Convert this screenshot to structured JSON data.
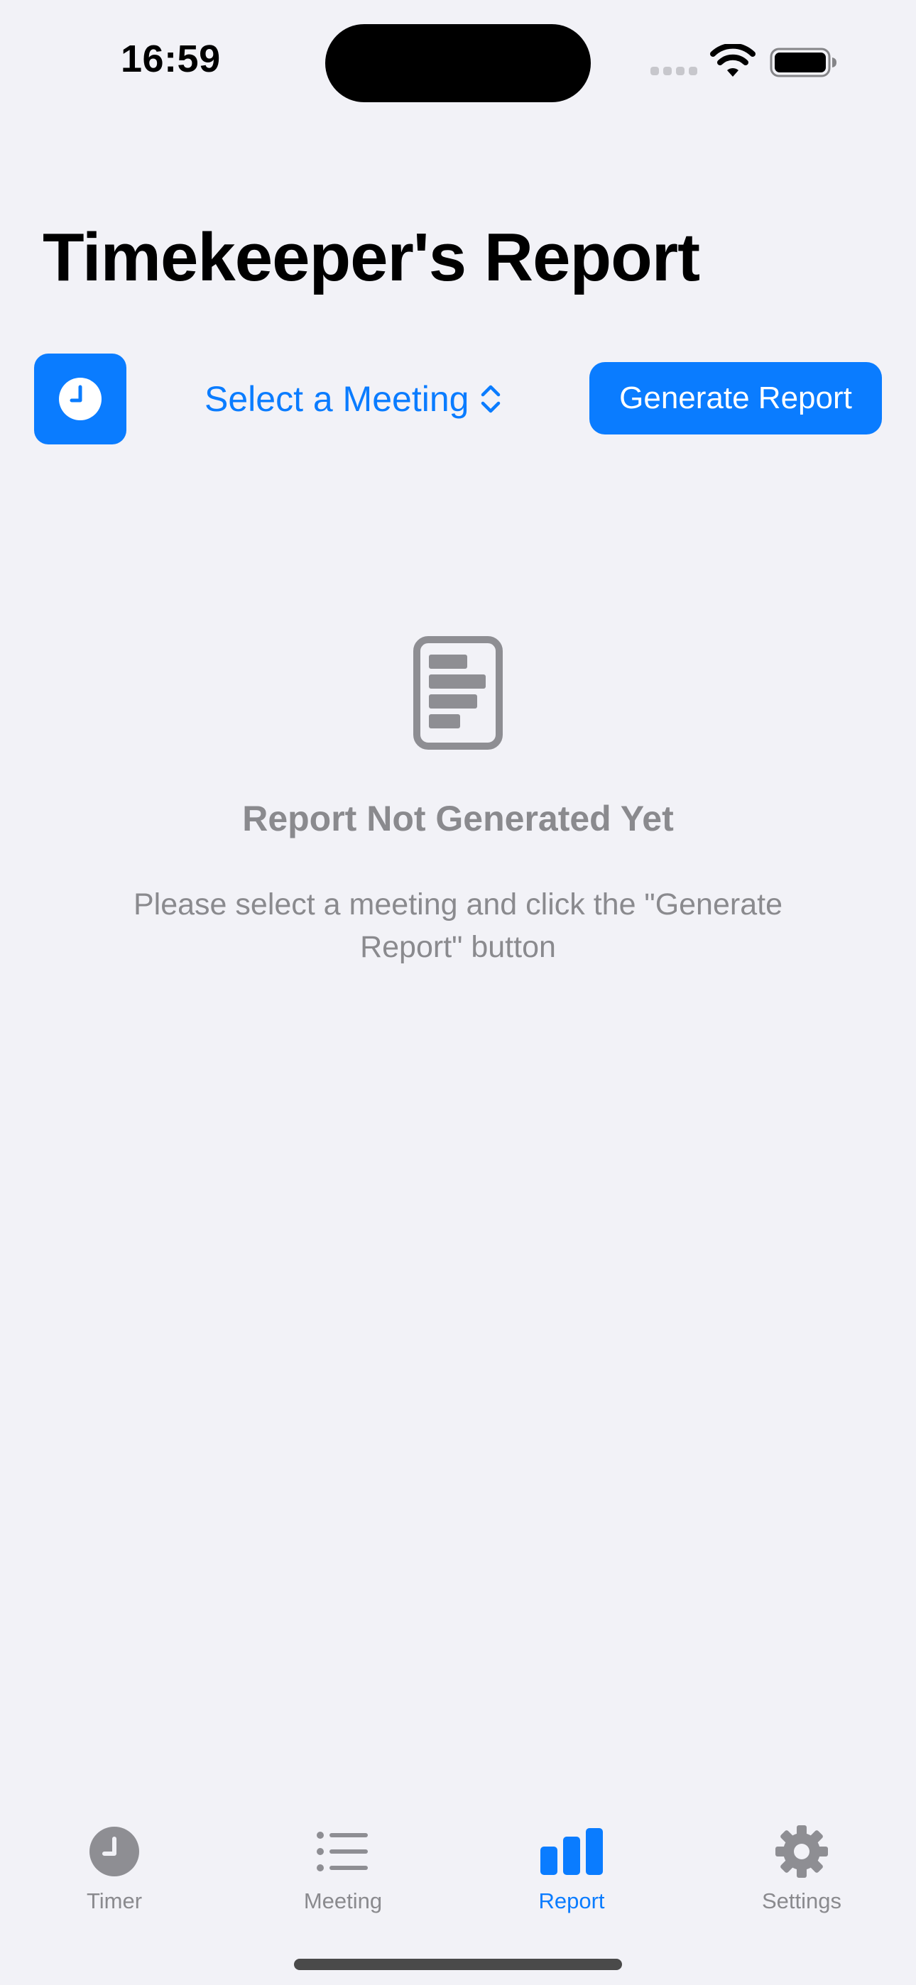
{
  "status_bar": {
    "time": "16:59"
  },
  "header": {
    "title": "Timekeeper's Report"
  },
  "toolbar": {
    "meeting_picker_label": "Select a Meeting",
    "generate_label": "Generate Report"
  },
  "empty_state": {
    "title": "Report Not Generated Yet",
    "message": "Please select a meeting and click the \"Generate Report\" button"
  },
  "tabs": [
    {
      "label": "Timer",
      "icon": "clock-icon",
      "active": false
    },
    {
      "label": "Meeting",
      "icon": "list-icon",
      "active": false
    },
    {
      "label": "Report",
      "icon": "bar-chart-icon",
      "active": true
    },
    {
      "label": "Settings",
      "icon": "gear-icon",
      "active": false
    }
  ],
  "colors": {
    "accent": "#0a7cff",
    "background": "#f2f2f7",
    "secondary_text": "#8a8a8e"
  }
}
